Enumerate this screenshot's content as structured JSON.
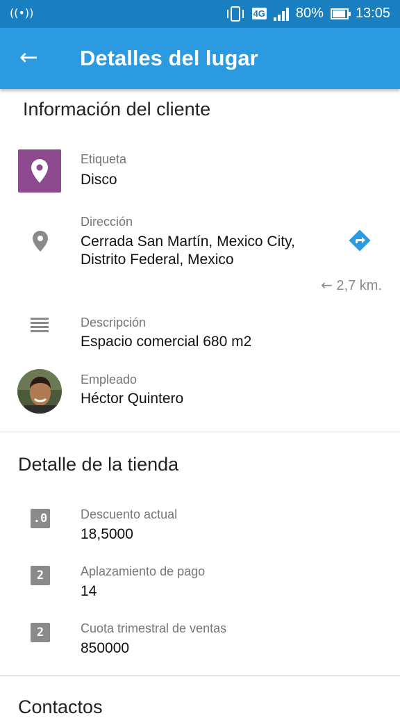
{
  "status": {
    "signal_left": "((•))",
    "network": "4G",
    "battery": "80%",
    "battery_level": 0.8,
    "time": "13:05"
  },
  "appbar": {
    "title": "Detalles del lugar"
  },
  "client": {
    "section_title": "Información del cliente",
    "tag_label": "Etiqueta",
    "tag_value": "Disco",
    "tag_color": "#8e4a8e",
    "address_label": "Dirección",
    "address_line1": "Cerrada San Martín, Mexico City,",
    "address_line2": "Distrito Federal, Mexico",
    "distance": "2,7 km.",
    "description_label": "Descripción",
    "description_value": "Espacio comercial 680 m2",
    "employee_label": "Empleado",
    "employee_value": "Héctor Quintero"
  },
  "store": {
    "section_title": "Detalle de la tienda",
    "fields": [
      {
        "icon": ".0",
        "label": "Descuento actual",
        "value": "18,5000"
      },
      {
        "icon": "2",
        "label": "Aplazamiento de pago",
        "value": "14"
      },
      {
        "icon": "2",
        "label": "Cuota trimestral de ventas",
        "value": "850000"
      }
    ]
  },
  "contacts": {
    "section_title": "Contactos"
  },
  "colors": {
    "statusbar": "#1a7fc0",
    "appbar": "#2b9ae0",
    "nav_icon": "#2b9ae0"
  }
}
